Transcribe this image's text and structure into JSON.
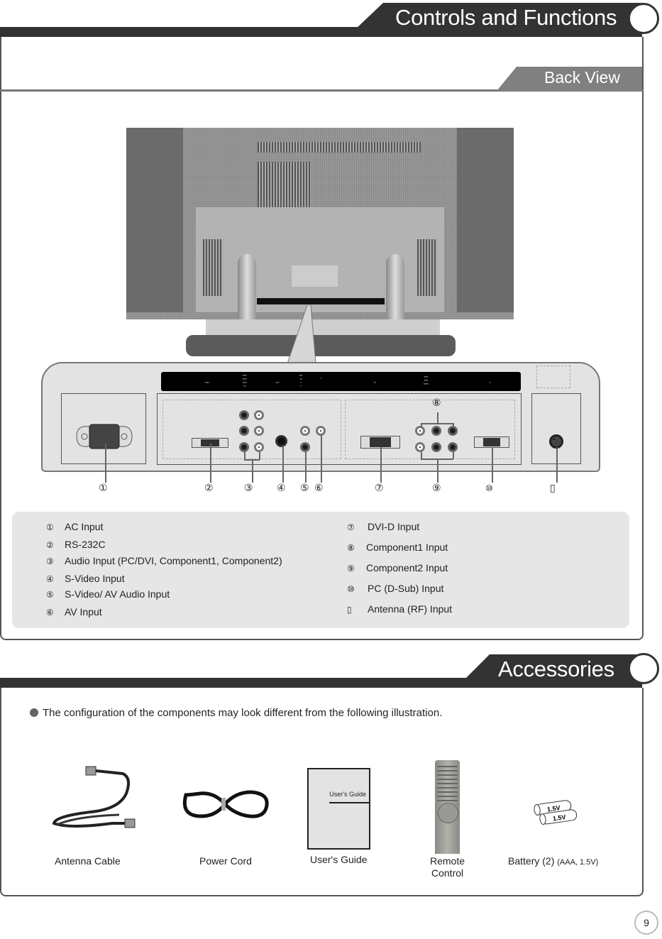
{
  "sections": {
    "controls": {
      "title": "Controls and Functions"
    },
    "back_view": {
      "title": "Back View"
    },
    "accessories": {
      "title": "Accessories"
    }
  },
  "back_view": {
    "illustration_callouts": [
      "①",
      "②",
      "③",
      "④",
      "⑤",
      "⑥",
      "⑦",
      "⑧",
      "⑨",
      "⑩",
      "▯"
    ],
    "legend_left": [
      {
        "num": "①",
        "label": "AC Input"
      },
      {
        "num": "②",
        "label": "RS-232C"
      },
      {
        "num": "③",
        "label": "Audio Input (PC/DVI, Component1, Component2)"
      },
      {
        "num": "④",
        "label": "S-Video Input"
      },
      {
        "num": "⑤",
        "label": "S-Video/ AV Audio Input"
      },
      {
        "num": "⑥",
        "label": "AV Input"
      }
    ],
    "legend_right": [
      {
        "num": "⑦",
        "label": "DVI-D Input"
      },
      {
        "num": "⑧",
        "label": "Component1 Input"
      },
      {
        "num": "⑨",
        "label": "Component2 Input"
      },
      {
        "num": "⑩",
        "label": "PC (D-Sub) Input"
      },
      {
        "num": "▯",
        "label": "Antenna (RF) Input"
      }
    ]
  },
  "accessories": {
    "note": "The configuration of the components may look different from the following illustration.",
    "items": [
      {
        "label": "Antenna Cable"
      },
      {
        "label": "Power Cord"
      },
      {
        "label": "User's Guide",
        "cover_text": "User's Guide"
      },
      {
        "label": "Remote",
        "label2": "Control"
      },
      {
        "label": "Battery (2)",
        "detail": "(AAA, 1.5V)",
        "battery_text": "1.5V"
      }
    ]
  },
  "page_number": "9"
}
